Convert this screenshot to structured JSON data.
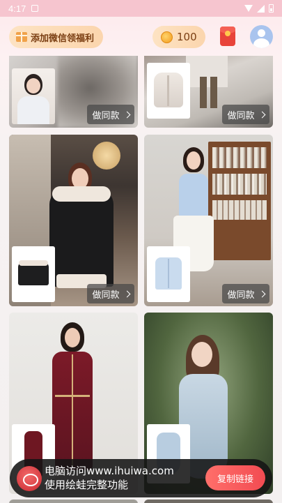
{
  "status_bar": {
    "time": "4:17"
  },
  "header": {
    "wechat_label": "添加微信领福利",
    "coins": "100"
  },
  "cards": [
    {
      "similar_label": "做同款"
    },
    {
      "similar_label": "做同款"
    },
    {
      "similar_label": "做同款"
    },
    {
      "similar_label": "做同款"
    }
  ],
  "promo": {
    "line1": "电脑访问www.ihuiwa.com",
    "line2": "使用绘蛙完整功能",
    "copy_label": "复制链接"
  },
  "colors": {
    "accent": "#f24b52",
    "coin_bg": "#fbd5ad",
    "status_bar": "#f6c5cf"
  }
}
